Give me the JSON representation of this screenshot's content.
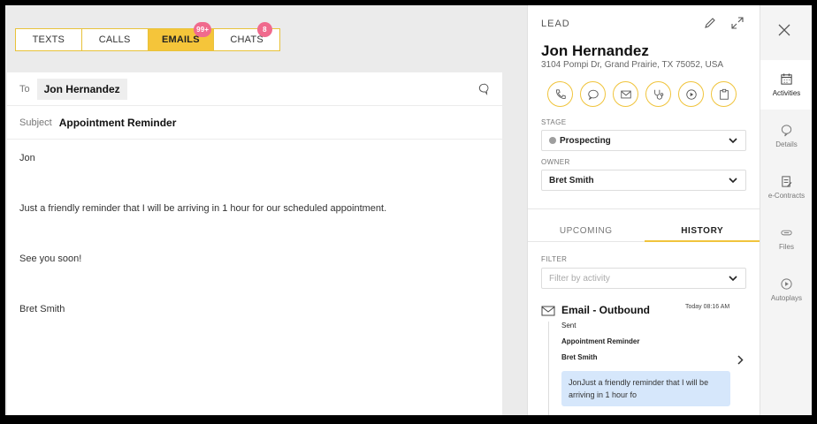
{
  "tabs": [
    {
      "label": "TEXTS",
      "badge": null,
      "active": false
    },
    {
      "label": "CALLS",
      "badge": null,
      "active": false
    },
    {
      "label": "EMAILS",
      "badge": "99+",
      "active": true
    },
    {
      "label": "CHATS",
      "badge": "8",
      "active": false
    }
  ],
  "compose": {
    "to_label": "To",
    "to_value": "Jon Hernandez",
    "subject_label": "Subject",
    "subject_value": "Appointment Reminder",
    "body": [
      "Jon",
      "Just a friendly reminder that I will be arriving in 1 hour for our scheduled appointment.",
      "See you soon!",
      "Bret Smith"
    ]
  },
  "lead": {
    "kicker": "LEAD",
    "name": "Jon Hernandez",
    "address": "3104 Pompi Dr, Grand Prairie, TX 75052, USA",
    "actions": [
      "phone-icon",
      "chat-bubble-icon",
      "mail-icon",
      "stethoscope-icon",
      "play-icon",
      "clipboard-icon"
    ],
    "stage_label": "STAGE",
    "stage_value": "Prospecting",
    "owner_label": "OWNER",
    "owner_value": "Bret Smith",
    "subtabs": [
      "UPCOMING",
      "HISTORY"
    ],
    "filter_label": "FILTER",
    "filter_placeholder": "Filter by activity",
    "activity": {
      "title": "Email - Outbound",
      "time": "Today 08:16 AM",
      "status": "Sent",
      "subject": "Appointment Reminder",
      "author": "Bret Smith",
      "preview": "JonJust a friendly reminder that I will be arriving in 1 hour fo"
    }
  },
  "rail": [
    {
      "label": "Activities",
      "icon": "calendar-icon",
      "active": true
    },
    {
      "label": "Details",
      "icon": "speech-bubble-icon",
      "active": false
    },
    {
      "label": "e-Contracts",
      "icon": "contract-icon",
      "active": false
    },
    {
      "label": "Files",
      "icon": "paperclip-icon",
      "active": false
    },
    {
      "label": "Autoplays",
      "icon": "autoplay-icon",
      "active": false
    }
  ],
  "colors": {
    "accent": "#f5c53a",
    "badge": "#f06a8d",
    "preview_bg": "#d6e7fb"
  }
}
